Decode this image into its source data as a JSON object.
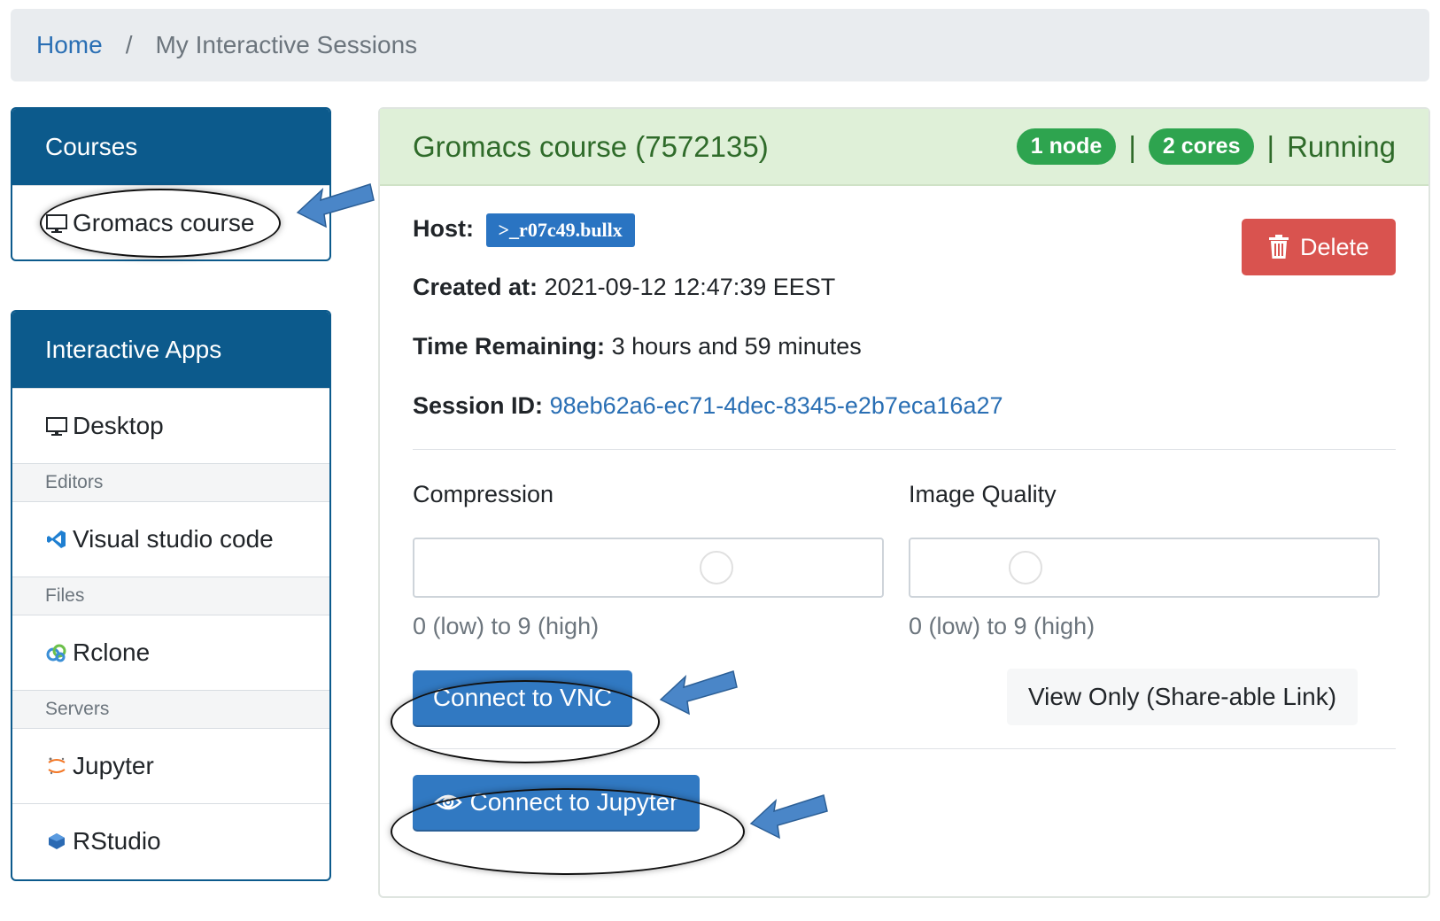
{
  "breadcrumb": {
    "home": "Home",
    "separator": "/",
    "current": "My Interactive Sessions"
  },
  "sidebar": {
    "courses": {
      "title": "Courses",
      "items": [
        {
          "label": "Gromacs course",
          "icon": "monitor-icon"
        }
      ]
    },
    "apps": {
      "title": "Interactive Apps",
      "desktop": "Desktop",
      "editors_header": "Editors",
      "vscode": "Visual studio code",
      "files_header": "Files",
      "rclone": "Rclone",
      "servers_header": "Servers",
      "jupyter": "Jupyter",
      "rstudio": "RStudio"
    }
  },
  "session": {
    "title": "Gromacs course (7572135)",
    "nodes_badge": "1 node",
    "cores_badge": "2 cores",
    "separator": "|",
    "status": "Running",
    "host_label": "Host:",
    "host_value": ">_r07c49.bullx",
    "created_label": "Created at:",
    "created_value": "2021-09-12 12:47:39 EEST",
    "time_label": "Time Remaining:",
    "time_value": "3 hours and 59 minutes",
    "sessionid_label": "Session ID:",
    "sessionid_value": "98eb62a6-ec71-4dec-8345-e2b7eca16a27",
    "delete_label": "Delete",
    "compression_label": "Compression",
    "compression_help": "0 (low) to 9 (high)",
    "compression_value": 6,
    "quality_label": "Image Quality",
    "quality_help": "0 (low) to 9 (high)",
    "quality_value": 2,
    "connect_vnc": "Connect to VNC",
    "view_only": "View Only (Share-able Link)",
    "connect_jupyter": "Connect to Jupyter"
  },
  "colors": {
    "header_blue": "#0c5a8c",
    "success_green": "#2ea44f",
    "danger_red": "#d9534f",
    "primary_blue": "#3179c2",
    "annotation_arrow": "#4a86c8"
  }
}
